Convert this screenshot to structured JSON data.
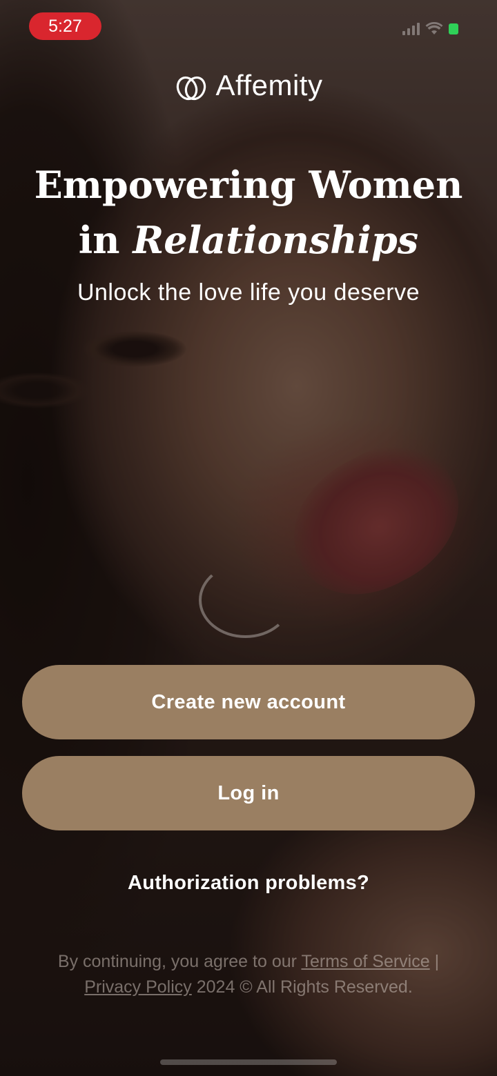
{
  "status_bar": {
    "time": "5:27",
    "time_pill_color": "#d9262e",
    "battery_color": "#2fd158",
    "icons": [
      "signal-icon",
      "wifi-icon",
      "battery-icon"
    ]
  },
  "logo": {
    "text": "Affemity",
    "icon": "intertwined-rings-logo-icon"
  },
  "hero": {
    "headline_line1": "Empowering Women",
    "headline_line2_prefix": "in",
    "headline_line2_accent": "Relationships",
    "subtitle": "Unlock the love life you deserve"
  },
  "actions": {
    "create_account": "Create new account",
    "log_in": "Log in",
    "auth_problems": "Authorization problems?",
    "button_color": "#9a7f62"
  },
  "legal": {
    "prefix": "By continuing, you agree to our",
    "terms": "Terms of Service",
    "separator": "|",
    "privacy": "Privacy Policy",
    "suffix": "2024 © All Rights Reserved."
  }
}
